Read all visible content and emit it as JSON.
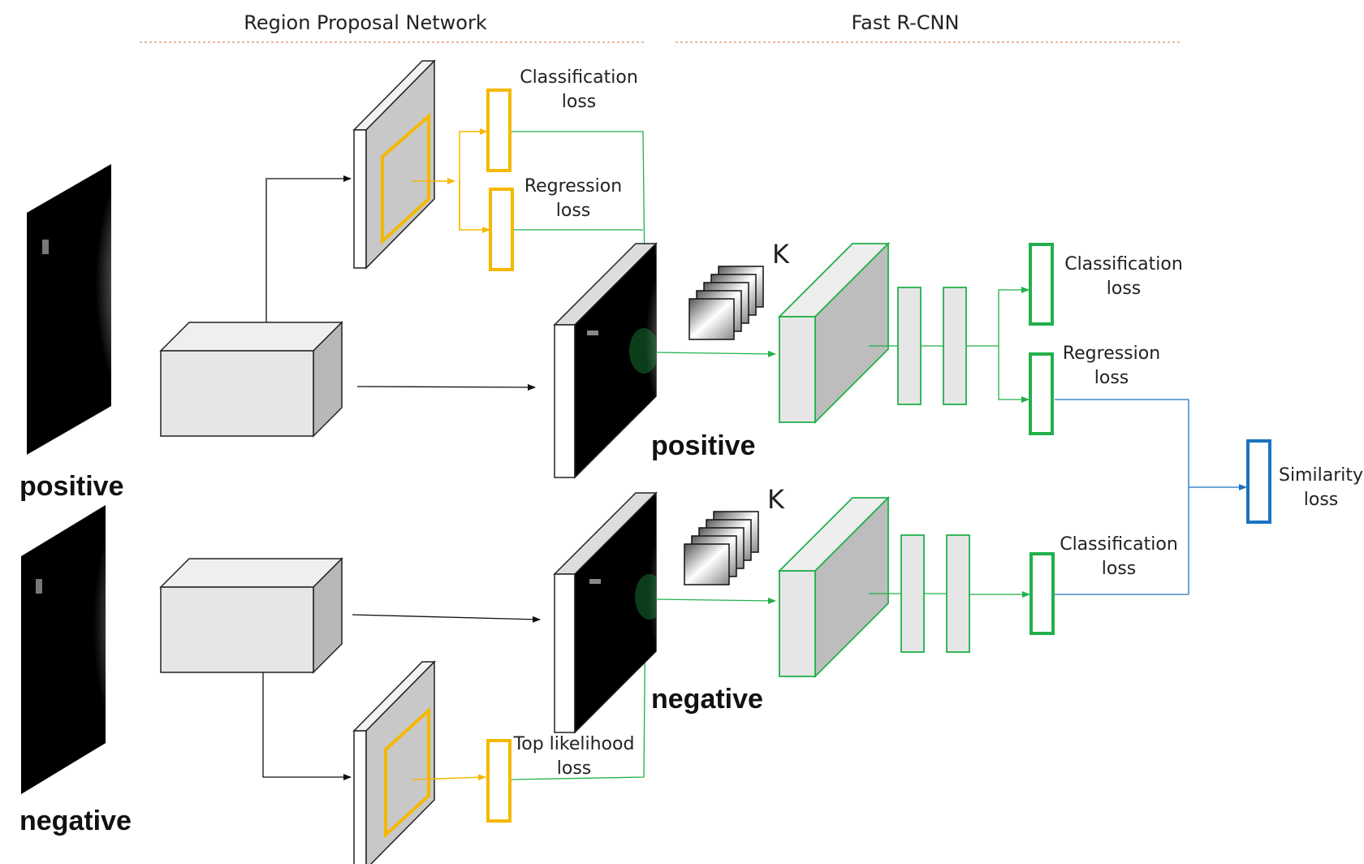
{
  "headers": {
    "rpn": "Region Proposal Network",
    "frcnn": "Fast R-CNN"
  },
  "inputs": {
    "positive": "positive",
    "negative": "negative"
  },
  "rpn_losses": {
    "cls_line1": "Classification",
    "cls_line2": "loss",
    "reg_line1": "Regression",
    "reg_line2": "loss",
    "top_line1": "Top likelihood",
    "top_line2": "loss"
  },
  "feature_maps": {
    "positive": "positive",
    "negative": "negative"
  },
  "roi_count": {
    "top": "K",
    "bottom": "K"
  },
  "frcnn_losses": {
    "top_cls_line1": "Classification",
    "top_cls_line2": "loss",
    "top_reg_line1": "Regression",
    "top_reg_line2": "loss",
    "bot_cls_line1": "Classification",
    "bot_cls_line2": "loss"
  },
  "similarity": {
    "line1": "Similarity",
    "line2": "loss"
  },
  "colors": {
    "rpn_accent": "#f5b800",
    "frcnn_accent": "#22b04b",
    "similarity_accent": "#1a73c0",
    "box_fill": "#e6e6e6",
    "map_fill": "#c8c8c8"
  }
}
